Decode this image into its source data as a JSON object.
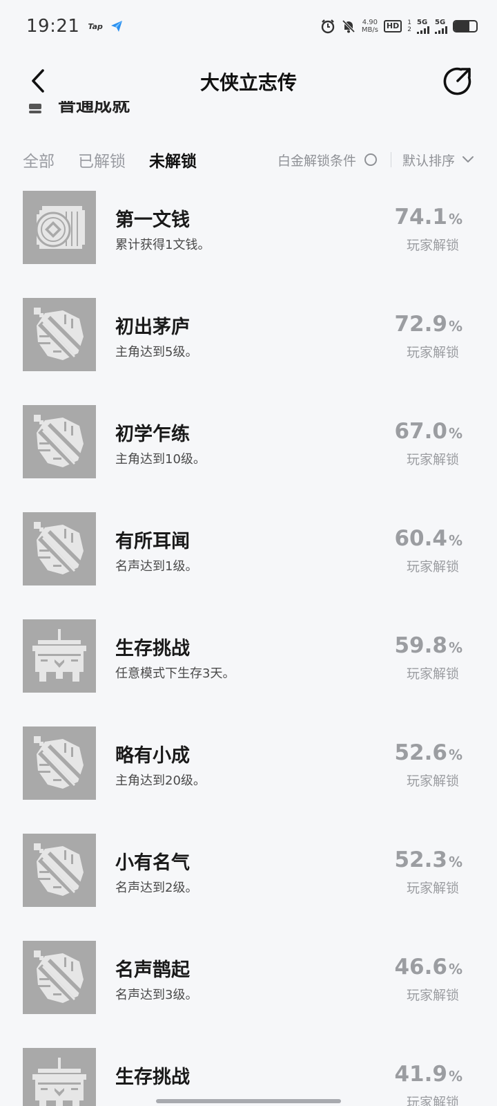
{
  "status_bar": {
    "time": "19:21",
    "tap_label": "Tap",
    "net_speed_value": "4.90",
    "net_speed_unit": "MB/s",
    "hd_label": "HD",
    "sim_top": "1",
    "sim_bottom": "2",
    "signal1_label": "5G",
    "signal2_label": "5G",
    "battery_level": 0.7
  },
  "nav": {
    "title": "大侠立志传"
  },
  "peek": {
    "text": "普通成就"
  },
  "filters": {
    "tabs": [
      {
        "label": "全部",
        "active": false
      },
      {
        "label": "已解锁",
        "active": false
      },
      {
        "label": "未解锁",
        "active": true
      }
    ],
    "platinum_label": "白金解锁条件",
    "sort_label": "默认排序"
  },
  "rate_label": "玩家解锁",
  "achievements": [
    {
      "icon": "coin-stack-icon",
      "name": "第一文钱",
      "desc": "累计获得1文钱。",
      "rate": "74.1"
    },
    {
      "icon": "sword-fist-icon",
      "name": "初出茅庐",
      "desc": "主角达到5级。",
      "rate": "72.9"
    },
    {
      "icon": "sword-fist-icon",
      "name": "初学乍练",
      "desc": "主角达到10级。",
      "rate": "67.0"
    },
    {
      "icon": "sword-fist-icon",
      "name": "有所耳闻",
      "desc": "名声达到1级。",
      "rate": "60.4"
    },
    {
      "icon": "incense-burner-icon",
      "name": "生存挑战",
      "desc": "任意模式下生存3天。",
      "rate": "59.8"
    },
    {
      "icon": "sword-fist-icon",
      "name": "略有小成",
      "desc": "主角达到20级。",
      "rate": "52.6"
    },
    {
      "icon": "sword-fist-icon",
      "name": "小有名气",
      "desc": "名声达到2级。",
      "rate": "52.3"
    },
    {
      "icon": "sword-fist-icon",
      "name": "名声鹊起",
      "desc": "名声达到3级。",
      "rate": "46.6"
    },
    {
      "icon": "incense-burner-icon",
      "name": "生存挑战",
      "desc": "",
      "rate": "41.9"
    }
  ],
  "colors": {
    "background": "#f6f7f9",
    "badge_bg": "#a9a9a9",
    "muted_text": "#9b9da1"
  }
}
